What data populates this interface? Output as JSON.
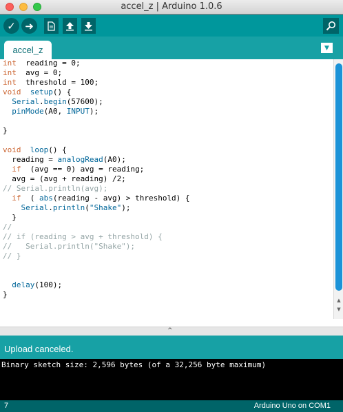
{
  "window": {
    "title": "accel_z | Arduino 1.0.6"
  },
  "toolbar": {
    "verify_icon": "checkmark-icon",
    "upload_icon": "right-arrow-icon",
    "new_icon": "new-file-icon",
    "open_icon": "open-arrow-up-icon",
    "save_icon": "save-arrow-down-icon",
    "serial_monitor_icon": "magnifier-icon"
  },
  "tabs": [
    {
      "label": "accel_z"
    }
  ],
  "editor": {
    "lines": [
      [
        [
          "kw",
          "int"
        ],
        [
          "",
          "  reading = 0;"
        ]
      ],
      [
        [
          "kw",
          "int"
        ],
        [
          "",
          "  avg = 0;"
        ]
      ],
      [
        [
          "kw",
          "int"
        ],
        [
          "",
          "  threshold = 100;"
        ]
      ],
      [
        [
          "kw",
          "void"
        ],
        [
          "",
          "  "
        ],
        [
          "fn",
          "setup"
        ],
        [
          "",
          "() {"
        ]
      ],
      [
        [
          "",
          "  "
        ],
        [
          "fn",
          "Serial"
        ],
        [
          "",
          "."
        ],
        [
          "fn",
          "begin"
        ],
        [
          "",
          "(57600);"
        ]
      ],
      [
        [
          "",
          "  "
        ],
        [
          "fn",
          "pinMode"
        ],
        [
          "",
          "(A0, "
        ],
        [
          "fn",
          "INPUT"
        ],
        [
          "",
          ");"
        ]
      ],
      [
        [
          "",
          ""
        ]
      ],
      [
        [
          "",
          "}"
        ]
      ],
      [
        [
          "",
          ""
        ]
      ],
      [
        [
          "kw",
          "void"
        ],
        [
          "",
          "  "
        ],
        [
          "fn",
          "loop"
        ],
        [
          "",
          "() {"
        ]
      ],
      [
        [
          "",
          "  reading = "
        ],
        [
          "fn",
          "analogRead"
        ],
        [
          "",
          "(A0);"
        ]
      ],
      [
        [
          "",
          "  "
        ],
        [
          "kw",
          "if"
        ],
        [
          "",
          "  (avg == 0) avg = reading;"
        ]
      ],
      [
        [
          "",
          "  avg = (avg + reading) /2;"
        ]
      ],
      [
        [
          "cm",
          "// Serial.println(avg);"
        ]
      ],
      [
        [
          "",
          "  "
        ],
        [
          "kw",
          "if"
        ],
        [
          "",
          "  ( "
        ],
        [
          "fn",
          "abs"
        ],
        [
          "",
          "(reading - avg) > threshold) {"
        ]
      ],
      [
        [
          "",
          "    "
        ],
        [
          "fn",
          "Serial"
        ],
        [
          "",
          "."
        ],
        [
          "fn",
          "println"
        ],
        [
          "",
          "("
        ],
        [
          "st",
          "\"Shake\""
        ],
        [
          "",
          ");"
        ]
      ],
      [
        [
          "",
          "  }"
        ]
      ],
      [
        [
          "cm",
          "//"
        ]
      ],
      [
        [
          "cm",
          "// if (reading > avg + threshold) {"
        ]
      ],
      [
        [
          "cm",
          "//   Serial.println(\"Shake\");"
        ]
      ],
      [
        [
          "cm",
          "// }"
        ]
      ],
      [
        [
          "",
          ""
        ]
      ],
      [
        [
          "",
          ""
        ]
      ],
      [
        [
          "",
          "  "
        ],
        [
          "fn",
          "delay"
        ],
        [
          "",
          "(100);"
        ]
      ],
      [
        [
          "",
          "}"
        ]
      ]
    ]
  },
  "status": {
    "message": "Upload canceled."
  },
  "console": {
    "output": "Binary sketch size: 2,596 bytes (of a 32,256 byte maximum)"
  },
  "footer": {
    "line_number": "7",
    "board": "Arduino Uno on COM1"
  },
  "colors": {
    "toolbar": "#00979c",
    "tabstrip": "#17a1a5",
    "keyword": "#cc6633",
    "function": "#006699",
    "comment": "#95a5a6",
    "footer": "#006468"
  }
}
